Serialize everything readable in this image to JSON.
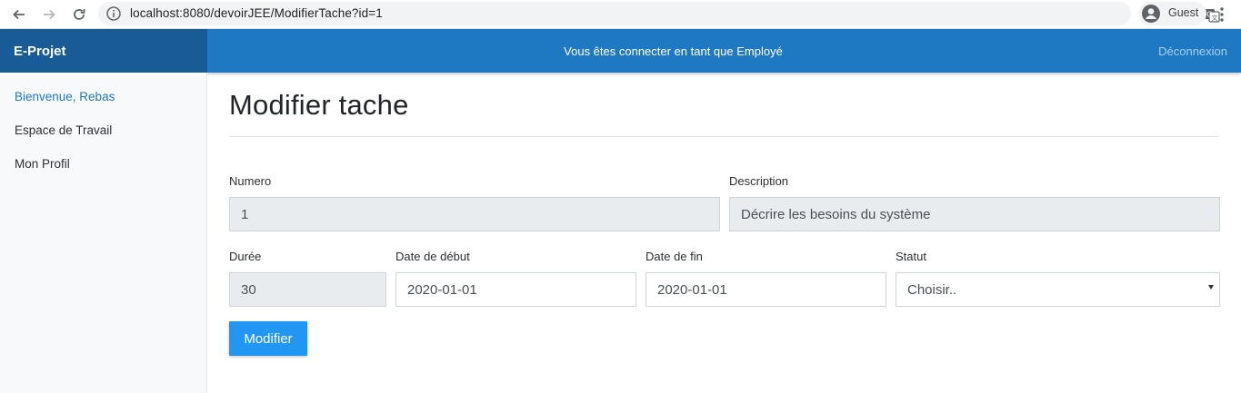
{
  "browser": {
    "url": "localhost:8080/devoirJEE/ModifierTache?id=1",
    "profile_label": "Guest"
  },
  "header": {
    "brand": "E-Projet",
    "message": "Vous êtes connecter en tant que Employé",
    "logout_label": "Déconnexion"
  },
  "sidebar": {
    "items": [
      {
        "label": "Bienvenue, Rebas"
      },
      {
        "label": "Espace de Travail"
      },
      {
        "label": "Mon Profil"
      }
    ]
  },
  "main": {
    "title": "Modifier tache",
    "form": {
      "numero": {
        "label": "Numero",
        "value": "1"
      },
      "description": {
        "label": "Description",
        "value": "Décrire les besoins du système"
      },
      "duree": {
        "label": "Durée",
        "value": "30"
      },
      "date_debut": {
        "label": "Date de début",
        "value": "2020-01-01"
      },
      "date_fin": {
        "label": "Date de fin",
        "value": "2020-01-01"
      },
      "statut": {
        "label": "Statut",
        "selected": "Choisir.."
      },
      "submit_label": "Modifier"
    }
  },
  "colors": {
    "header_bg": "#1e78c2",
    "brand_bg": "#195b94",
    "button_bg": "#2196f3",
    "active_link": "#1e78c2"
  }
}
